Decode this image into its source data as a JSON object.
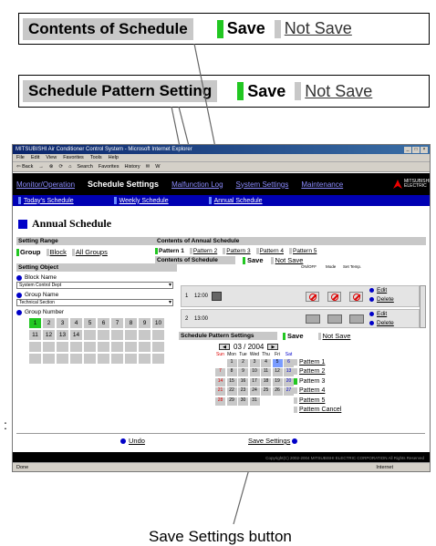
{
  "callout_contents": {
    "label": "Contents of Schedule",
    "save": "Save",
    "not_save": "Not Save"
  },
  "callout_pattern": {
    "label": "Schedule Pattern Setting",
    "save": "Save",
    "not_save": "Not Save"
  },
  "caption": "Save Settings button",
  "colon_mark": ":",
  "browser": {
    "title": "MITSUBISHI Air Conditioner Control System - Microsoft Internet Explorer",
    "window_controls": [
      "_",
      "□",
      "×"
    ],
    "menu": [
      "File",
      "Edit",
      "View",
      "Favorites",
      "Tools",
      "Help"
    ],
    "toolbar": [
      "⇦ Back",
      "→",
      "⊗",
      "⟳",
      "⌂",
      "Search",
      "Favorites",
      "History",
      "✉",
      "W"
    ],
    "status_left": "Done",
    "status_right": "Internet"
  },
  "app": {
    "nav": {
      "monitor": "Monitor/Operation",
      "schedule": "Schedule Settings",
      "malfunction": "Malfunction Log",
      "system": "System Settings",
      "maintenance": "Maintenance"
    },
    "logo_text": "MITSUBISHI ELECTRIC",
    "subnav": {
      "today": "Today's Schedule",
      "weekly": "Weekly Schedule",
      "annual": "Annual Schedule"
    },
    "page_title": "Annual Schedule",
    "setting_range": {
      "header": "Setting Range",
      "group": "Group",
      "block": "Block",
      "all_groups": "All Groups"
    },
    "setting_object": {
      "header": "Setting Object",
      "block_name_label": "Block Name",
      "block_name_value": "System Control Dept",
      "group_name_label": "Group Name",
      "group_name_value": "Technical Section",
      "group_number_label": "Group Number",
      "groups_row1": [
        "1",
        "2",
        "3",
        "4",
        "5",
        "6",
        "7",
        "8",
        "9",
        "10"
      ],
      "groups_row2": [
        "11",
        "12",
        "13",
        "14"
      ]
    },
    "annual": {
      "header": "Contents of Annual Schedule",
      "patterns": [
        "Pattern 1",
        "Pattern 2",
        "Pattern 3",
        "Pattern 4",
        "Pattern 5"
      ],
      "contents_label": "Contents of Schedule",
      "save": "Save",
      "not_save": "Not Save",
      "col_onoff": "ON/OFF",
      "col_mode": "Mode",
      "col_settemp": "Set Temp.",
      "rows": [
        {
          "num": "1",
          "time": "12:00",
          "edit": "Edit",
          "delete": "Delete"
        },
        {
          "num": "2",
          "time": "13:00",
          "edit": "Edit",
          "delete": "Delete"
        }
      ]
    },
    "pattern_setting": {
      "label": "Schedule Pattern Settings",
      "save": "Save",
      "not_save": "Not Save",
      "month": "03 / 2004",
      "days": [
        "Sun",
        "Mon",
        "Tue",
        "Wed",
        "Thu",
        "Fri",
        "Sat"
      ],
      "weeks": [
        [
          "",
          "1",
          "2",
          "3",
          "4",
          "5",
          "6"
        ],
        [
          "7",
          "8",
          "9",
          "10",
          "11",
          "12",
          "13"
        ],
        [
          "14",
          "15",
          "16",
          "17",
          "18",
          "19",
          "20"
        ],
        [
          "21",
          "22",
          "23",
          "24",
          "25",
          "26",
          "27"
        ],
        [
          "28",
          "29",
          "30",
          "31",
          "",
          "",
          ""
        ]
      ],
      "pattern_list": [
        "Pattern 1",
        "Pattern 2",
        "Pattern 3",
        "Pattern 4",
        "Pattern 5",
        "Pattern Cancel"
      ]
    },
    "undo": "Undo",
    "save_settings": "Save Settings",
    "copyright": "Copyright(C) 2002-2004 MITSUBISHI ELECTRIC CORPORATION All Rights Reserved"
  }
}
